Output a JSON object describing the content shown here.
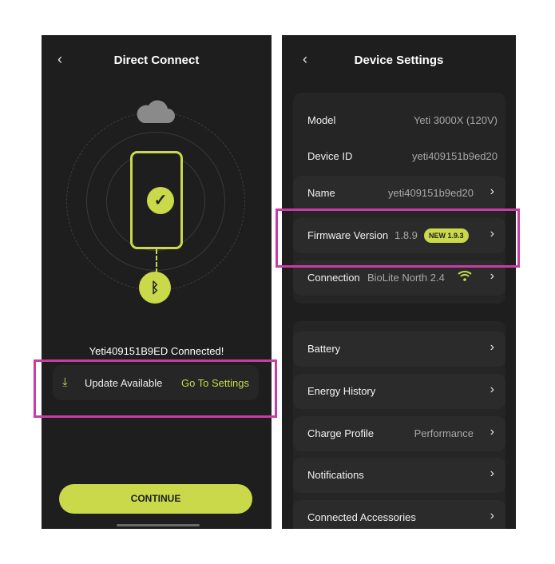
{
  "left_screen": {
    "header": {
      "back_icon": "chevron-left-icon",
      "title": "Direct Connect"
    },
    "illustration": {
      "icons": [
        "cloud-icon",
        "phone-icon",
        "checkmark-icon",
        "bluetooth-icon"
      ]
    },
    "connected_text": "Yeti409151B9ED Connected!",
    "update_card": {
      "icon": "download-icon",
      "label": "Update Available",
      "link": "Go To Settings"
    },
    "continue_button": "CONTINUE"
  },
  "right_screen": {
    "header": {
      "back_icon": "chevron-left-icon",
      "title": "Device Settings"
    },
    "info": [
      {
        "label": "Model",
        "value": "Yeti 3000X (120V)"
      },
      {
        "label": "Device ID",
        "value": "yeti409151b9ed20"
      },
      {
        "label": "Name",
        "value": "yeti409151b9ed20"
      },
      {
        "label": "Firmware Version",
        "value": "1.8.9",
        "badge": "NEW 1.9.3"
      },
      {
        "label": "Connection",
        "value": "BioLite North 2.4"
      }
    ],
    "menu": [
      {
        "label": "Battery",
        "value": ""
      },
      {
        "label": "Energy History",
        "value": ""
      },
      {
        "label": "Charge Profile",
        "value": "Performance"
      },
      {
        "label": "Notifications",
        "value": ""
      },
      {
        "label": "Connected Accessories",
        "value": ""
      }
    ]
  },
  "colors": {
    "accent": "#c9d94a",
    "background": "#1e1e1e",
    "card": "#2b2b2b",
    "highlight": "#c93ca3"
  }
}
